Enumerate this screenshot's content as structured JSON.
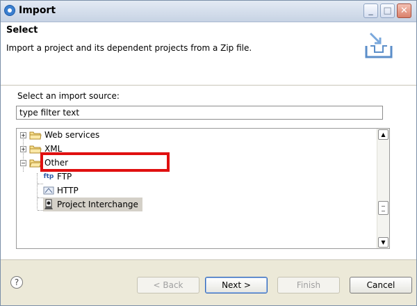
{
  "window": {
    "title": "Import"
  },
  "header": {
    "title": "Select",
    "description": "Import a project and its dependent projects from a Zip file."
  },
  "source": {
    "label": "Select an import source:",
    "filter_value": "type filter text"
  },
  "tree": {
    "items": [
      {
        "label": "Web services",
        "type": "folder",
        "expander": "+"
      },
      {
        "label": "XML",
        "type": "folder",
        "expander": "+"
      },
      {
        "label": "Other",
        "type": "folder",
        "expander": "−"
      },
      {
        "label": "FTP",
        "type": "leaf",
        "icon": "ftp-icon",
        "icon_text": "ftp"
      },
      {
        "label": "HTTP",
        "type": "leaf",
        "icon": "http-icon"
      },
      {
        "label": "Project Interchange",
        "type": "leaf",
        "icon": "project-interchange-icon",
        "selected": true
      }
    ]
  },
  "buttons": {
    "back": "< Back",
    "next": "Next >",
    "finish": "Finish",
    "cancel": "Cancel"
  },
  "colors": {
    "highlight": "#e01010",
    "selection": "#d4d0c8"
  }
}
